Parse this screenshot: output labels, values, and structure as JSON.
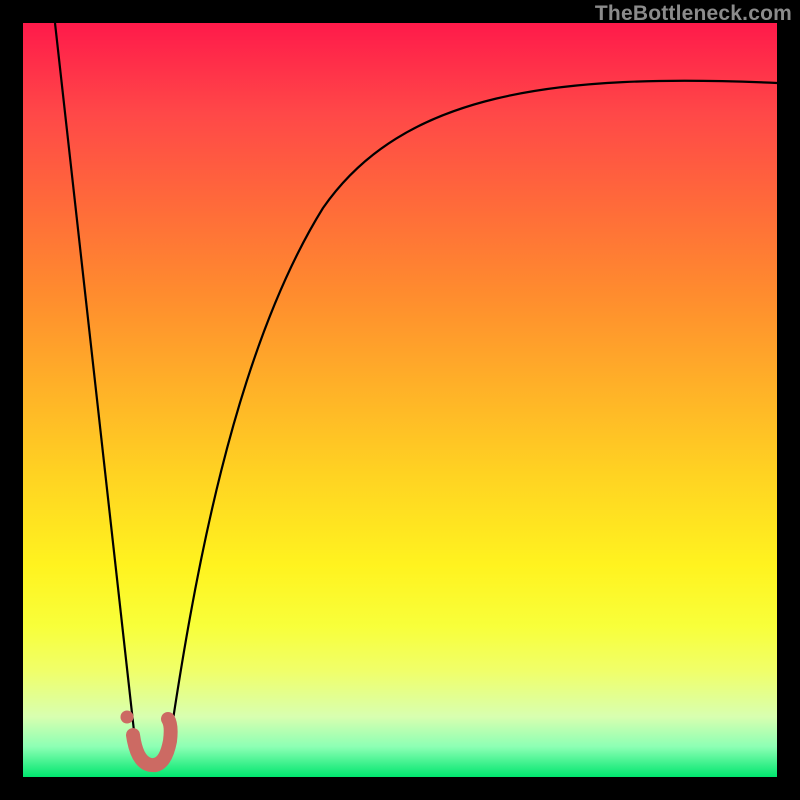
{
  "watermark": "TheBottleneck.com",
  "chart_data": {
    "type": "line",
    "title": "",
    "xlabel": "",
    "ylabel": "",
    "xlim": [
      0,
      100
    ],
    "ylim": [
      0,
      100
    ],
    "series": [
      {
        "name": "left-branch",
        "x": [
          4,
          7,
          10,
          13,
          15
        ],
        "y": [
          100,
          75,
          50,
          25,
          4
        ]
      },
      {
        "name": "right-branch",
        "x": [
          19,
          22,
          26,
          30,
          36,
          44,
          54,
          66,
          80,
          100
        ],
        "y": [
          3,
          20,
          40,
          55,
          68,
          78,
          84,
          88,
          90,
          92
        ]
      },
      {
        "name": "highlight-hook",
        "x": [
          14.5,
          15.5,
          17,
          18,
          19,
          19.5,
          19
        ],
        "y": [
          5.5,
          2.3,
          1.7,
          1.7,
          2.5,
          5,
          7.5
        ]
      },
      {
        "name": "highlight-dot",
        "x": [
          13.9
        ],
        "y": [
          8
        ]
      }
    ],
    "colors": {
      "branches": "#000000",
      "highlight": "#cc6a63"
    }
  }
}
